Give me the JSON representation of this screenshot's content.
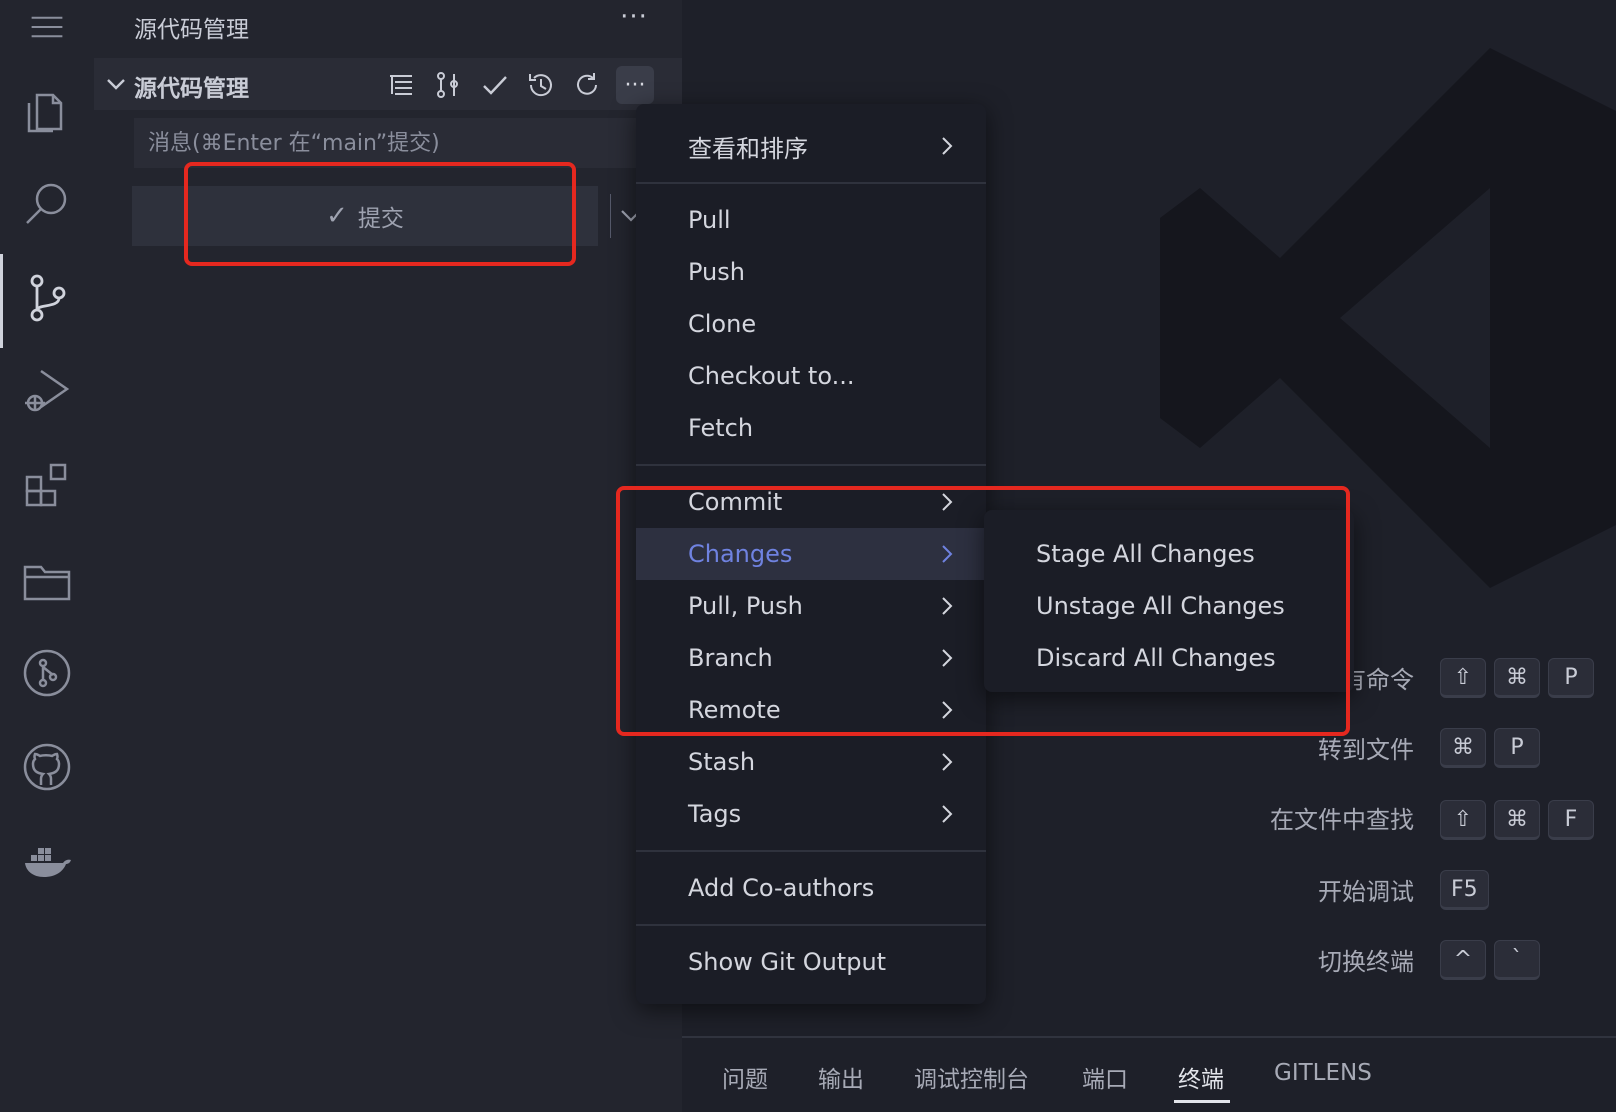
{
  "sidebar": {
    "title": "源代码管理",
    "more": "···",
    "section_title": "源代码管理",
    "commit_placeholder": "消息(⌘Enter 在“main”提交)",
    "commit_label": "提交",
    "commit_check": "✓",
    "tool_more": "···"
  },
  "menu": {
    "view_sort": "查看和排序",
    "pull": "Pull",
    "push": "Push",
    "clone": "Clone",
    "checkout": "Checkout to...",
    "fetch": "Fetch",
    "commit": "Commit",
    "changes": "Changes",
    "pull_push": "Pull, Push",
    "branch": "Branch",
    "remote": "Remote",
    "stash": "Stash",
    "tags": "Tags",
    "add_coauthors": "Add Co-authors",
    "show_git_output": "Show Git Output"
  },
  "submenu": {
    "stage_all": "Stage All Changes",
    "unstage_all": "Unstage All Changes",
    "discard_all": "Discard All Changes"
  },
  "hints": {
    "all_commands": "有命令",
    "go_to_file": "转到文件",
    "find_in_files": "在文件中查找",
    "start_debug": "开始调试",
    "toggle_terminal": "切换终端",
    "k_shift": "⇧",
    "k_cmd": "⌘",
    "k_p": "P",
    "k_f": "F",
    "k_f5": "F5",
    "k_ctrl": "^",
    "k_backtick": "`"
  },
  "panel": {
    "problems": "问题",
    "output": "输出",
    "debug_console": "调试控制台",
    "ports": "端口",
    "terminal": "终端",
    "gitlens": "GITLENS"
  },
  "colors": {
    "highlight": "#e5281f",
    "active_menu_text": "#6f82e0"
  }
}
